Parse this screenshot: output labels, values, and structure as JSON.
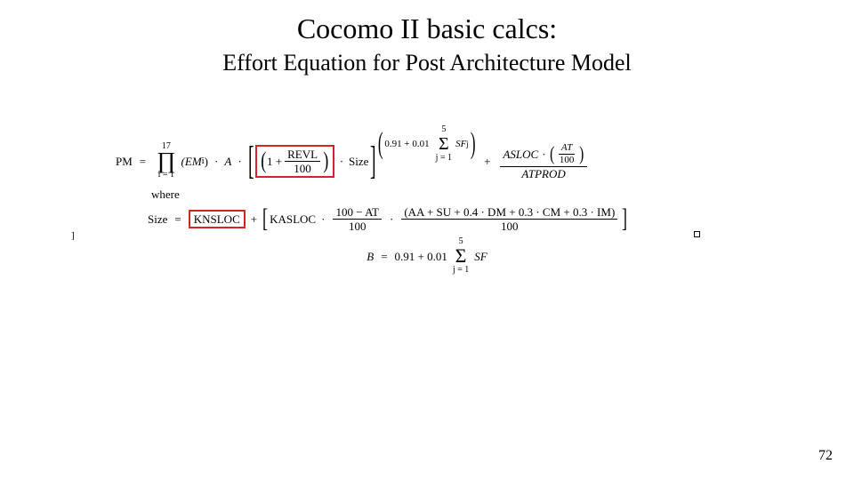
{
  "title": "Cocomo II basic calcs:",
  "subtitle": "Effort Equation for Post Architecture Model",
  "page_number": "72",
  "eq": {
    "pm": "PM",
    "equals": "=",
    "prod_upper": "17",
    "prod_op": "∏",
    "prod_lower": "i = 1",
    "em": "(EM",
    "em_sub": "i",
    "em_close": ")",
    "dot": "·",
    "A": "A",
    "one_plus": "1 +",
    "revl": "REVL",
    "hundred": "100",
    "size": "Size",
    "exp_pre": "0.91 + 0.01",
    "sum_op": "Σ",
    "sum_upper": "5",
    "sum_lower": "j = 1",
    "sf": "SF",
    "sf_sub": "j",
    "plus": "+",
    "asloc": "ASLOC",
    "at": "AT",
    "atprod": "ATPROD",
    "where": "where",
    "size_lhs": "Size",
    "knsloc": "KNSLOC",
    "kasloc": "KASLOC",
    "hundred_minus_at": "100 − AT",
    "aa_expr": "(AA + SU + 0.4 · DM + 0.3 · CM + 0.3 · IM)",
    "B": "B",
    "b_pre": "0.91 + 0.01",
    "stray_left": "]",
    "stray_right": "□"
  }
}
